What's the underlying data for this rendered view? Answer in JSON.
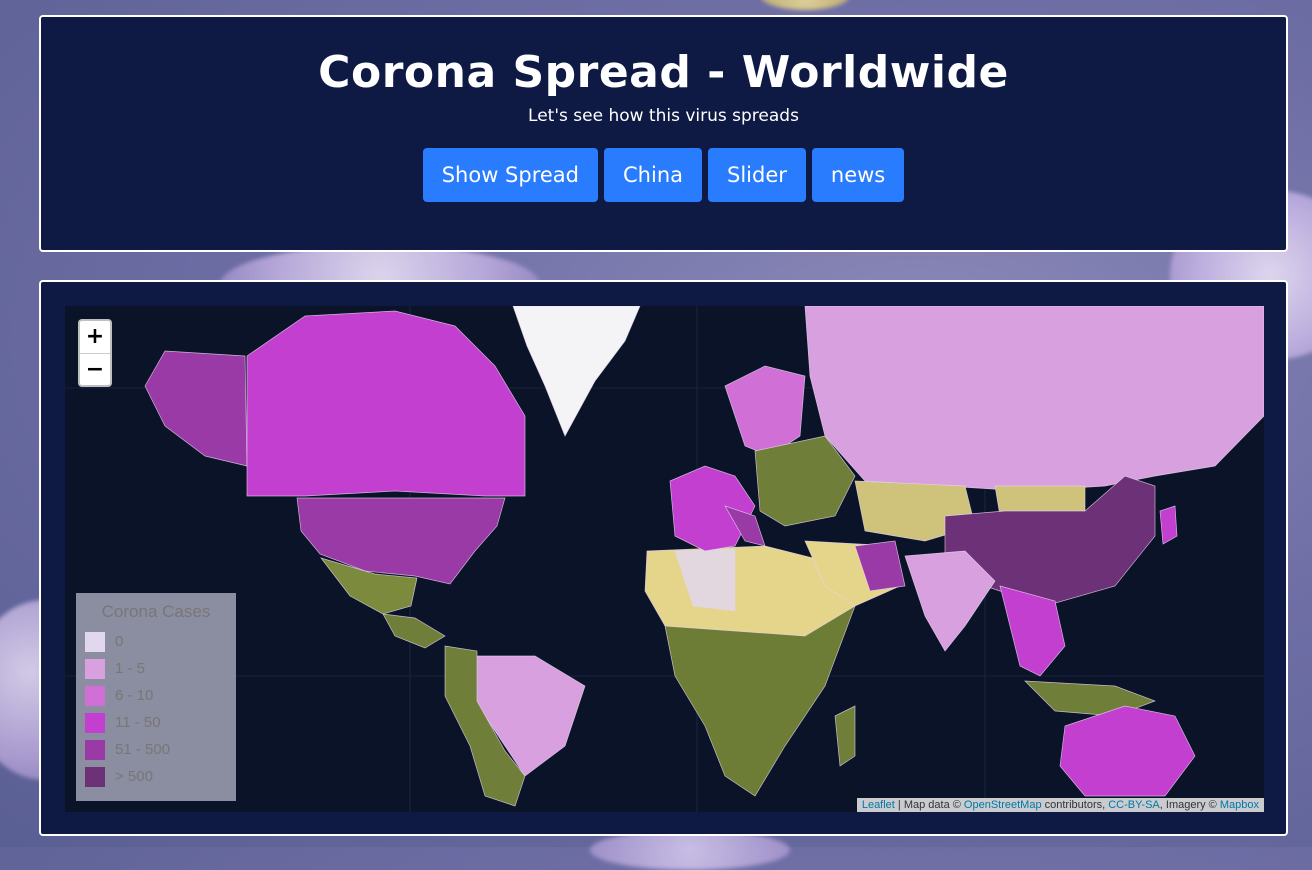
{
  "header": {
    "title": "Corona Spread - Worldwide",
    "subtitle": "Let's see how this virus spreads",
    "buttons": [
      "Show Spread",
      "China",
      "Slider",
      "news"
    ]
  },
  "map": {
    "zoom_in": "+",
    "zoom_out": "−",
    "legend": {
      "title": "Corona Cases",
      "items": [
        {
          "label": "0",
          "color": "#e2d8ee"
        },
        {
          "label": "1 - 5",
          "color": "#d9a0e0"
        },
        {
          "label": "6 - 10",
          "color": "#d06fd6"
        },
        {
          "label": "11 - 50",
          "color": "#c33fd0"
        },
        {
          "label": "51 - 500",
          "color": "#9a3aa6"
        },
        {
          "label": "> 500",
          "color": "#6d3178"
        }
      ]
    },
    "attribution": {
      "leaflet": "Leaflet",
      "sep": " | Map data © ",
      "osm": "OpenStreetMap",
      "contributors": " contributors, ",
      "license": "CC-BY-SA",
      "imagery": ", Imagery © ",
      "mapbox": "Mapbox"
    }
  },
  "colors": {
    "panel_bg": "#0f1a44",
    "button_bg": "#2a7cff",
    "ocean": "#0a1328"
  }
}
